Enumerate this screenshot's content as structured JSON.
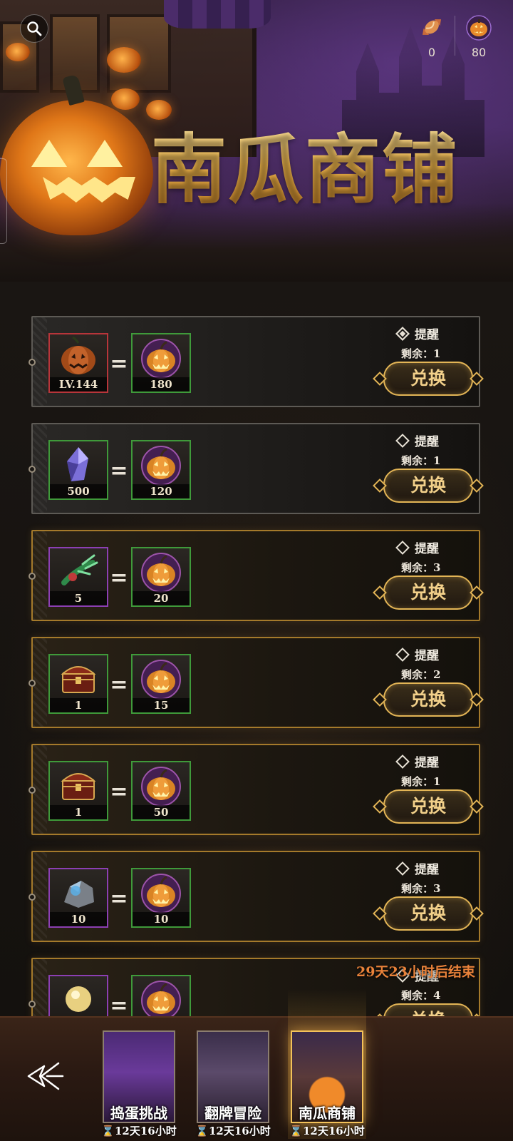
{
  "header": {
    "title": "南瓜商铺",
    "currencies": [
      {
        "icon": "candy-icon",
        "value": "0"
      },
      {
        "icon": "pumpkin-coin-icon",
        "value": "80"
      }
    ]
  },
  "shop": {
    "remind_label": "提醒",
    "remain_prefix": "剩余：",
    "exchange_label": "兑换",
    "items": [
      {
        "cost_icon": "pumpkin-item-icon",
        "cost_qty": "LV.144",
        "reward_qty": "180",
        "remain": "1",
        "remind_on": true,
        "border": "red"
      },
      {
        "cost_icon": "crystal-icon",
        "cost_qty": "500",
        "reward_qty": "120",
        "remain": "1",
        "remind_on": false,
        "border": "green"
      },
      {
        "cost_icon": "claw-icon",
        "cost_qty": "5",
        "reward_qty": "20",
        "remain": "3",
        "remind_on": false,
        "border": "purple"
      },
      {
        "cost_icon": "chest-icon",
        "cost_qty": "1",
        "reward_qty": "15",
        "remain": "2",
        "remind_on": false,
        "border": "green"
      },
      {
        "cost_icon": "chest-icon",
        "cost_qty": "1",
        "reward_qty": "50",
        "remain": "1",
        "remind_on": false,
        "border": "green"
      },
      {
        "cost_icon": "ore-icon",
        "cost_qty": "10",
        "reward_qty": "10",
        "remain": "3",
        "remind_on": false,
        "border": "purple"
      },
      {
        "cost_icon": "orb-icon",
        "cost_qty": "",
        "reward_qty": "",
        "remain": "4",
        "remind_on": false,
        "border": "purple"
      }
    ],
    "end_note": "29天23小时后结束"
  },
  "bottom_nav": {
    "tabs": [
      {
        "label": "捣蛋挑战",
        "timer": "12天16小时",
        "active": false
      },
      {
        "label": "翻牌冒险",
        "timer": "12天16小时",
        "active": false
      },
      {
        "label": "南瓜商铺",
        "timer": "12天16小时",
        "active": true
      }
    ]
  },
  "colors": {
    "gold": "#e3b556",
    "title_gold": "#f0b84a",
    "end_note": "#e9823a",
    "slot_green": "#3f9a3a",
    "slot_purple": "#8c3fb3",
    "slot_red": "#b8353a"
  }
}
